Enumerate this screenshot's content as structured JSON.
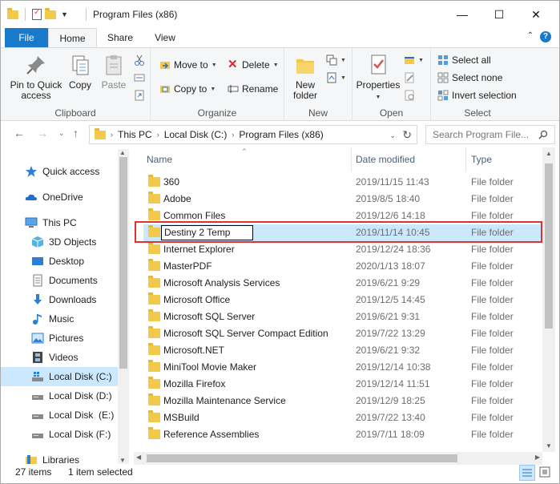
{
  "window": {
    "title": "Program Files (x86)",
    "minimize_glyph": "—",
    "maximize_glyph": "☐",
    "close_glyph": "✕"
  },
  "tabs": {
    "file": "File",
    "home": "Home",
    "share": "Share",
    "view": "View",
    "help_glyph": "?"
  },
  "ribbon": {
    "clipboard": {
      "label": "Clipboard",
      "pin": "Pin to Quick access",
      "copy": "Copy",
      "paste": "Paste"
    },
    "organize": {
      "label": "Organize",
      "move_to": "Move to",
      "copy_to": "Copy to",
      "delete": "Delete",
      "rename": "Rename"
    },
    "new": {
      "label": "New",
      "new_folder": "New folder"
    },
    "open": {
      "label": "Open",
      "properties": "Properties"
    },
    "select": {
      "label": "Select",
      "select_all": "Select all",
      "select_none": "Select none",
      "invert": "Invert selection"
    }
  },
  "address": {
    "crumbs": [
      "This PC",
      "Local Disk (C:)",
      "Program Files (x86)"
    ],
    "search_placeholder": "Search Program File..."
  },
  "nav": {
    "quick_access": "Quick access",
    "onedrive": "OneDrive",
    "this_pc": "This PC",
    "objects3d": "3D Objects",
    "desktop": "Desktop",
    "documents": "Documents",
    "downloads": "Downloads",
    "music": "Music",
    "pictures": "Pictures",
    "videos": "Videos",
    "disk_c": "Local Disk (C:)",
    "disk_d": "Local Disk (D:)",
    "disk_e": "Local Disk  (E:)",
    "disk_f": "Local Disk (F:)",
    "libraries": "Libraries"
  },
  "columns": {
    "name": "Name",
    "date": "Date modified",
    "type": "Type"
  },
  "files": [
    {
      "name": "360",
      "date": "2019/11/15 11:43",
      "type": "File folder"
    },
    {
      "name": "Adobe",
      "date": "2019/8/5 18:40",
      "type": "File folder"
    },
    {
      "name": "Common Files",
      "date": "2019/12/6 14:18",
      "type": "File folder"
    },
    {
      "name": "Destiny 2 Temp",
      "date": "2019/11/14 10:45",
      "type": "File folder"
    },
    {
      "name": "Internet Explorer",
      "date": "2019/12/24 18:36",
      "type": "File folder"
    },
    {
      "name": "MasterPDF",
      "date": "2020/1/13 18:07",
      "type": "File folder"
    },
    {
      "name": "Microsoft Analysis Services",
      "date": "2019/6/21 9:29",
      "type": "File folder"
    },
    {
      "name": "Microsoft Office",
      "date": "2019/12/5 14:45",
      "type": "File folder"
    },
    {
      "name": "Microsoft SQL Server",
      "date": "2019/6/21 9:31",
      "type": "File folder"
    },
    {
      "name": "Microsoft SQL Server Compact Edition",
      "date": "2019/7/22 13:29",
      "type": "File folder"
    },
    {
      "name": "Microsoft.NET",
      "date": "2019/6/21 9:32",
      "type": "File folder"
    },
    {
      "name": "MiniTool Movie Maker",
      "date": "2019/12/14 10:38",
      "type": "File folder"
    },
    {
      "name": "Mozilla Firefox",
      "date": "2019/12/14 11:51",
      "type": "File folder"
    },
    {
      "name": "Mozilla Maintenance Service",
      "date": "2019/12/9 18:25",
      "type": "File folder"
    },
    {
      "name": "MSBuild",
      "date": "2019/7/22 13:40",
      "type": "File folder"
    },
    {
      "name": "Reference Assemblies",
      "date": "2019/7/11 18:09",
      "type": "File folder"
    }
  ],
  "status": {
    "items": "27 items",
    "selected": "1 item selected"
  },
  "colors": {
    "accent": "#1979ca",
    "selection": "#cce8ff",
    "highlight_border": "#e03030",
    "folder": "#f3c94b"
  }
}
